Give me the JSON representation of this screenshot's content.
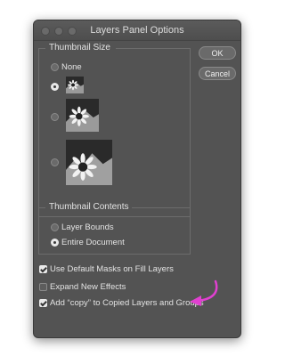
{
  "dialog": {
    "title": "Layers Panel Options"
  },
  "thumbnail_size": {
    "heading": "Thumbnail Size",
    "none_label": "None",
    "selected": "small"
  },
  "buttons": {
    "ok": "OK",
    "cancel": "Cancel"
  },
  "thumbnail_contents": {
    "heading": "Thumbnail Contents",
    "layer_bounds": "Layer Bounds",
    "entire_document": "Entire Document",
    "selected": "entire_document"
  },
  "options": {
    "use_default_masks": {
      "label": "Use Default Masks on Fill Layers",
      "checked": true
    },
    "expand_new_effects": {
      "label": "Expand New Effects",
      "checked": false
    },
    "add_copy": {
      "label": "Add “copy” to Copied Layers and Groups",
      "checked": true
    }
  },
  "colors": {
    "dialog_bg": "#535353",
    "annotation_arrow": "#e040d0"
  }
}
